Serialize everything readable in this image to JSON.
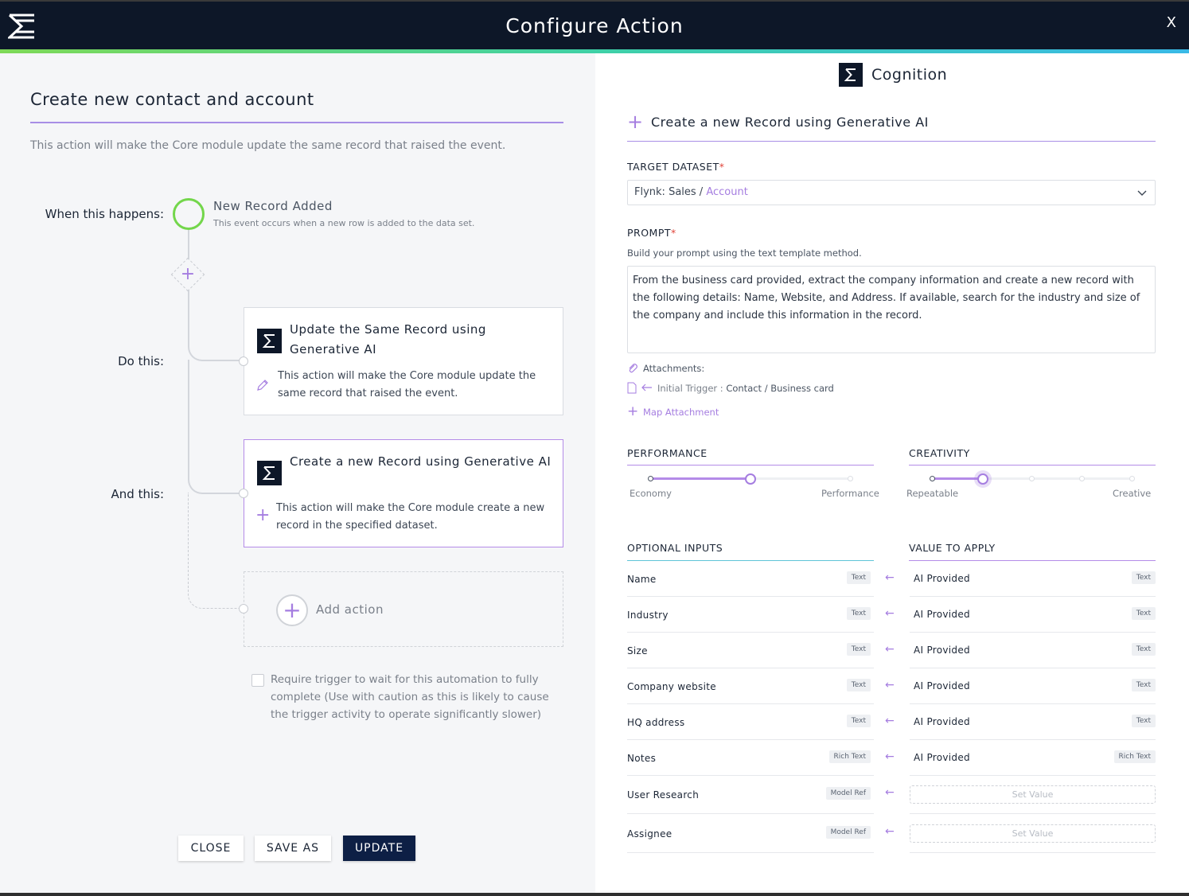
{
  "header": {
    "title": "Configure Action",
    "close_label": "X",
    "accent_gradient": [
      "#7ed957",
      "#39b9e6"
    ]
  },
  "left": {
    "title": "Create new contact and account",
    "description": "This action will make the Core module update the same record that raised the event.",
    "when_label": "When this happens:",
    "do_label": "Do this:",
    "and_label": "And this:",
    "trigger": {
      "title": "New Record Added",
      "description": "This event occurs when a new row is added to the data set."
    },
    "actions": [
      {
        "title": "Update the Same Record using Generative AI",
        "description": "This action will make the Core module update the same record that raised the event.",
        "icon": "pencil-icon"
      },
      {
        "title": "Create a new Record using Generative AI",
        "description": "This action will make the Core module create a new record in the specified dataset.",
        "icon": "plus-icon",
        "selected": true
      }
    ],
    "add_action_label": "Add action",
    "checkbox_text": "Require trigger to wait for this automation to fully complete (Use with caution as this is likely to cause the trigger activity to operate significantly slower)",
    "buttons": {
      "close": "CLOSE",
      "save_as": "SAVE AS",
      "update": "UPDATE"
    }
  },
  "right": {
    "brand": "Cognition",
    "action_title": "Create a new Record using Generative AI",
    "target_dataset_label": "TARGET DATASET",
    "target_dataset": {
      "prefix": "Flynk: Sales / ",
      "entity": "Account"
    },
    "prompt_label": "PROMPT",
    "prompt_hint": "Build your prompt using the text template method.",
    "prompt_text": "From the business card provided, extract the company information and create a new record with the following details: Name, Website, and Address. If available, search for the industry and size of the company and include this information in the record.",
    "attachments_label": "Attachments:",
    "attachment": {
      "source": "Initial Trigger :",
      "target": "Contact / Business card"
    },
    "map_attachment_label": "Map Attachment",
    "performance": {
      "label": "PERFORMANCE",
      "min_label": "Economy",
      "max_label": "Performance",
      "level": 0.5
    },
    "creativity": {
      "label": "CREATIVITY",
      "min_label": "Repeatable",
      "max_label": "Creative",
      "level": 0.25
    },
    "optional_inputs_label": "OPTIONAL INPUTS",
    "value_to_apply_label": "VALUE TO APPLY",
    "inputs": [
      {
        "name": "Name",
        "type": "Text",
        "value": "AI Provided",
        "value_type": "Text"
      },
      {
        "name": "Industry",
        "type": "Text",
        "value": "AI Provided",
        "value_type": "Text"
      },
      {
        "name": "Size",
        "type": "Text",
        "value": "AI Provided",
        "value_type": "Text"
      },
      {
        "name": "Company website",
        "type": "Text",
        "value": "AI Provided",
        "value_type": "Text"
      },
      {
        "name": "HQ address",
        "type": "Text",
        "value": "AI Provided",
        "value_type": "Text"
      },
      {
        "name": "Notes",
        "type": "Rich Text",
        "value": "AI Provided",
        "value_type": "Rich Text"
      },
      {
        "name": "User Research",
        "type": "Model Ref",
        "placeholder": "Set Value"
      },
      {
        "name": "Assignee",
        "type": "Model Ref",
        "placeholder": "Set Value"
      }
    ]
  }
}
